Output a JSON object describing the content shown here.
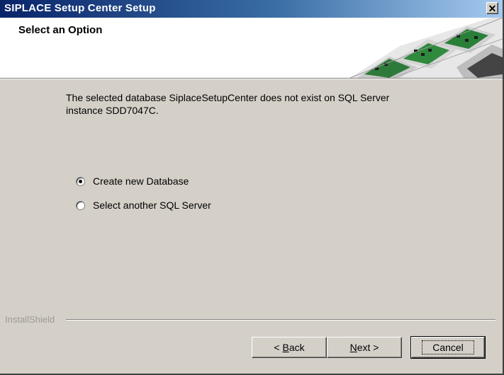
{
  "window": {
    "title": "SIPLACE Setup Center Setup",
    "close_glyph": "✕"
  },
  "banner": {
    "title": "Select an Option",
    "artwork_icon": "pcb-assembly-machine-artwork"
  },
  "content": {
    "message_line1": "The selected database SiplaceSetupCenter does not exist on SQL Server",
    "message_line2": "instance SDD7047C.",
    "options": [
      {
        "label": "Create new Database",
        "selected": true
      },
      {
        "label": "Select another SQL Server",
        "selected": false
      }
    ]
  },
  "footer": {
    "brand": "InstallShield",
    "back_prefix": "< ",
    "back_mnemonic": "B",
    "back_rest": "ack",
    "next_mnemonic": "N",
    "next_rest": "ext >",
    "cancel_label": "Cancel"
  },
  "colors": {
    "titlebar_start": "#0a246a",
    "titlebar_end": "#a6caf0",
    "dialog_face": "#d4d0c8"
  }
}
